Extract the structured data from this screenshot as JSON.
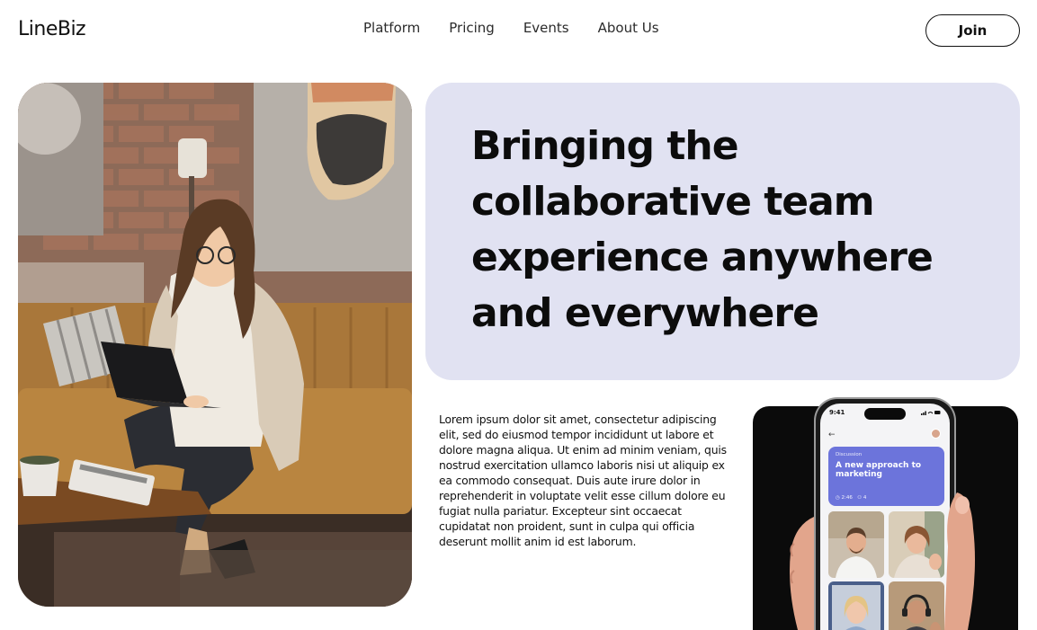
{
  "header": {
    "logo": "LineBiz",
    "nav": [
      "Platform",
      "Pricing",
      "Events",
      "About Us"
    ],
    "join_label": "Join"
  },
  "hero": {
    "headline": "Bringing the collaborative team experience anywhere and everywhere",
    "body": "Lorem ipsum dolor sit amet, consectetur adipiscing elit, sed do eiusmod tempor incididunt ut labore et dolore magna aliqua. Ut enim ad minim veniam, quis nostrud exercitation ullamco laboris nisi ut aliquip ex ea commodo consequat. Duis aute irure dolor in reprehenderit in voluptate velit esse cillum dolore eu fugiat nulla pariatur. Excepteur sint occaecat cupidatat non proident, sunt in culpa qui officia deserunt mollit anim id est laborum."
  },
  "phone": {
    "time": "9:41",
    "card_label": "Discussion",
    "card_title": "A new approach to marketing",
    "card_time": "◷ 2:46",
    "card_people": "⚇ 4"
  },
  "colors": {
    "headline_panel": "#e1e2f2",
    "discussion_card": "#6c74db",
    "phone_card": "#0b0b0b"
  },
  "icons": [
    "back-arrow-icon",
    "clock-icon",
    "people-icon",
    "signal-icon",
    "wifi-icon",
    "battery-icon"
  ]
}
